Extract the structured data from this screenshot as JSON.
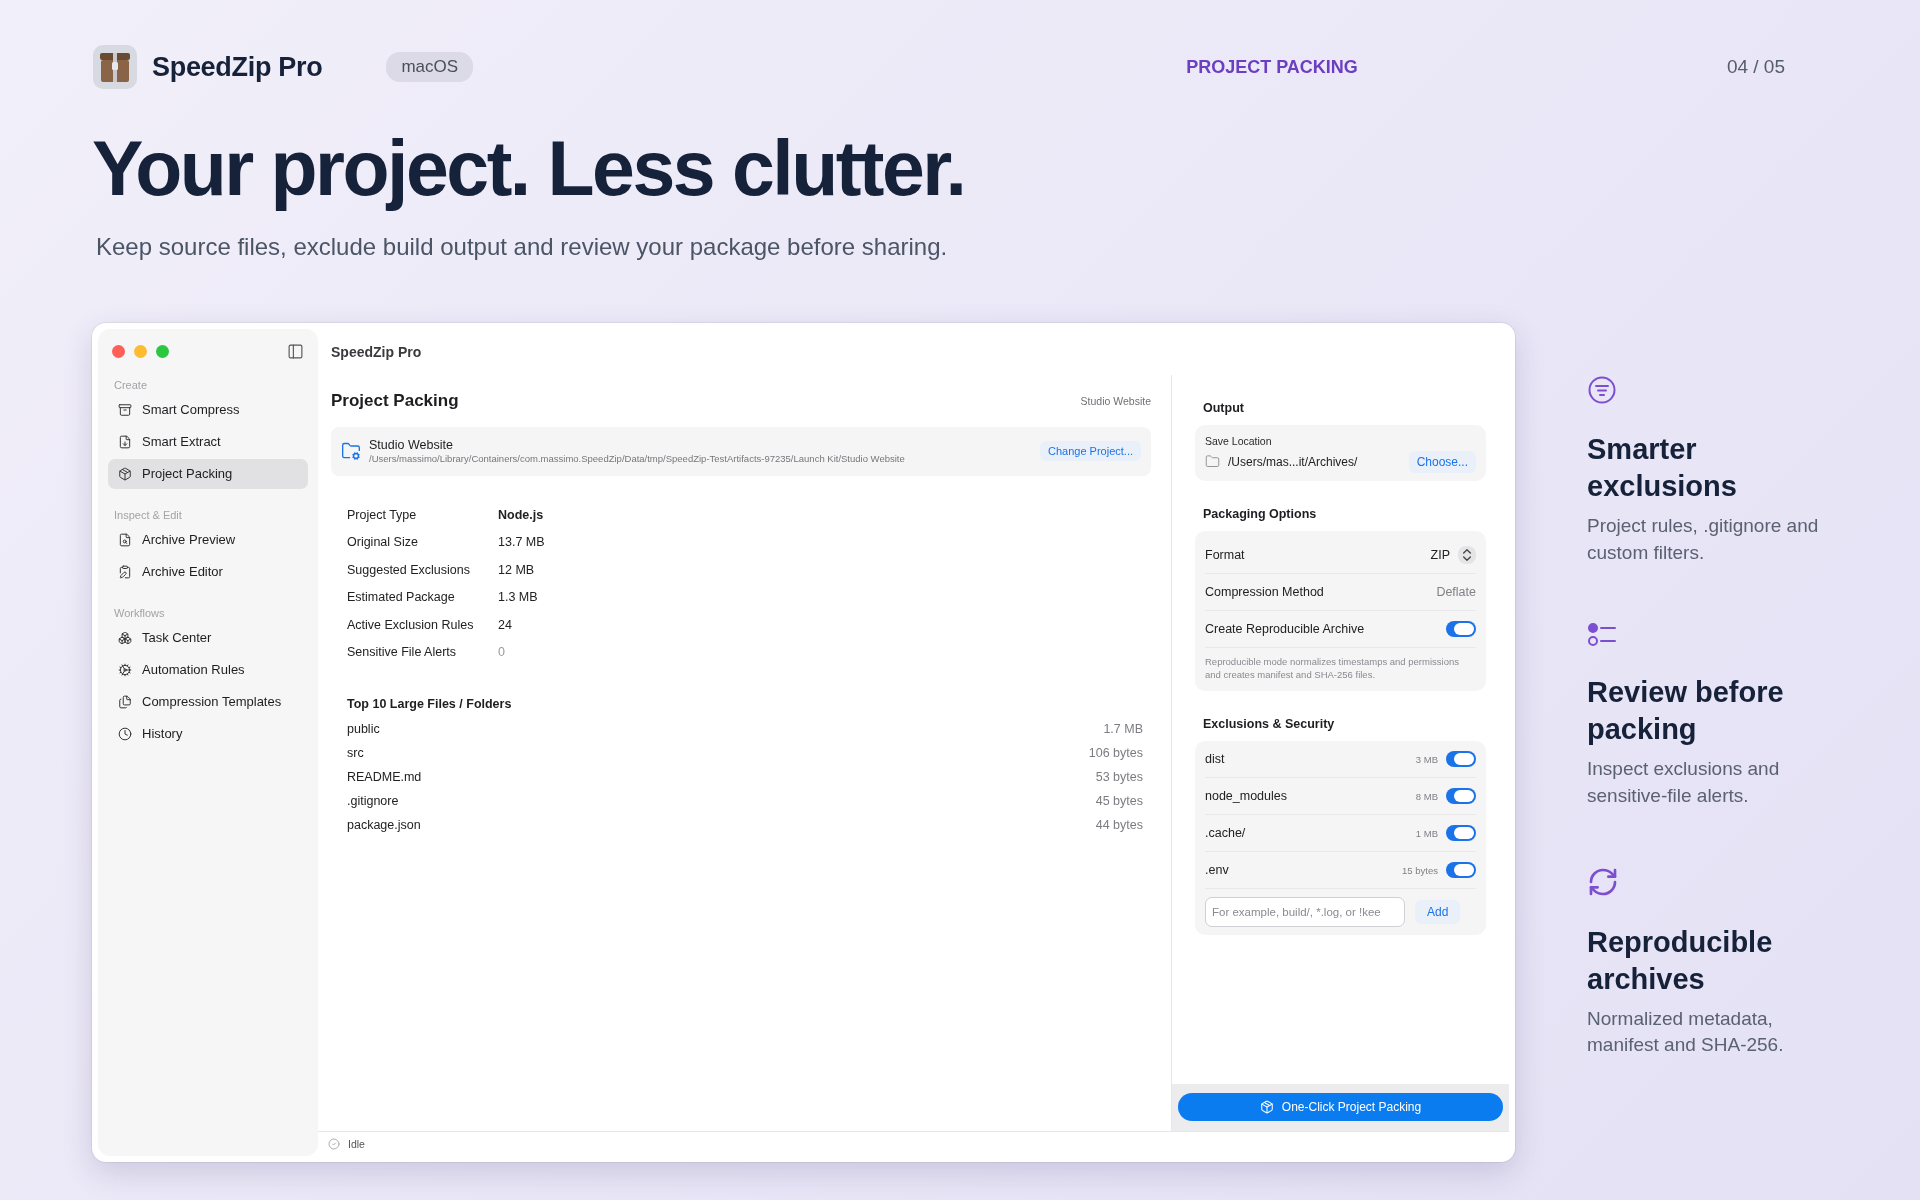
{
  "header": {
    "app_name": "SpeedZip Pro",
    "platform_badge": "macOS",
    "section_label": "PROJECT PACKING",
    "page_counter": "04 / 05"
  },
  "headline": "Your project. Less clutter.",
  "subtitle": "Keep source files, exclude build output and review your package before sharing.",
  "window": {
    "title": "SpeedZip Pro",
    "sidebar": {
      "sections": [
        {
          "heading": "Create",
          "items": [
            {
              "label": "Smart Compress",
              "selected": false
            },
            {
              "label": "Smart Extract",
              "selected": false
            },
            {
              "label": "Project Packing",
              "selected": true
            }
          ]
        },
        {
          "heading": "Inspect & Edit",
          "items": [
            {
              "label": "Archive Preview",
              "selected": false
            },
            {
              "label": "Archive Editor",
              "selected": false
            }
          ]
        },
        {
          "heading": "Workflows",
          "items": [
            {
              "label": "Task Center",
              "selected": false
            },
            {
              "label": "Automation Rules",
              "selected": false
            },
            {
              "label": "Compression Templates",
              "selected": false
            },
            {
              "label": "History",
              "selected": false
            }
          ]
        }
      ]
    },
    "main": {
      "title": "Project Packing",
      "project_badge": "Studio Website",
      "project": {
        "name": "Studio Website",
        "path": "/Users/massimo/Library/Containers/com.massimo.SpeedZip/Data/tmp/SpeedZip-TestArtifacts-97235/Launch Kit/Studio Website",
        "action": "Change Project..."
      },
      "stats": [
        {
          "label": "Project Type",
          "value": "Node.js",
          "kind": "bold"
        },
        {
          "label": "Original Size",
          "value": "13.7 MB",
          "kind": "plain"
        },
        {
          "label": "Suggested Exclusions",
          "value": "12 MB",
          "kind": "plain"
        },
        {
          "label": "Estimated Package",
          "value": "1.3 MB",
          "kind": "plain"
        },
        {
          "label": "Active Exclusion Rules",
          "value": "24",
          "kind": "plain"
        },
        {
          "label": "Sensitive File Alerts",
          "value": "0",
          "kind": "muted"
        }
      ],
      "files": {
        "heading": "Top 10 Large Files / Folders",
        "rows": [
          {
            "name": "public",
            "size": "1.7 MB"
          },
          {
            "name": "src",
            "size": "106 bytes"
          },
          {
            "name": "README.md",
            "size": "53 bytes"
          },
          {
            "name": ".gitignore",
            "size": "45 bytes"
          },
          {
            "name": "package.json",
            "size": "44 bytes"
          }
        ]
      }
    },
    "panel": {
      "output": {
        "heading": "Output",
        "save_label": "Save Location",
        "path": "/Users/mas...it/Archives/",
        "button": "Choose..."
      },
      "options": {
        "heading": "Packaging Options",
        "rows": [
          {
            "kind": "select",
            "label": "Format",
            "value": "ZIP"
          },
          {
            "kind": "value",
            "label": "Compression Method",
            "value": "Deflate"
          },
          {
            "kind": "toggle",
            "label": "Create Reproducible Archive",
            "on": true
          }
        ],
        "note": "Reproducible mode normalizes timestamps and permissions and creates manifest and SHA-256 files."
      },
      "exclusions": {
        "heading": "Exclusions & Security",
        "rows": [
          {
            "name": "dist",
            "size": "3 MB",
            "on": true
          },
          {
            "name": "node_modules",
            "size": "8 MB",
            "on": true
          },
          {
            "name": ".cache/",
            "size": "1 MB",
            "on": true
          },
          {
            "name": ".env",
            "size": "15 bytes",
            "on": true
          }
        ],
        "input": {
          "placeholder": "For example, build/, *.log, or !kee"
        },
        "add": "Add"
      },
      "action_button": "One-Click Project Packing"
    },
    "status": "Idle"
  },
  "features": [
    {
      "title": "Smarter exclusions",
      "text": "Project rules, .gitignore and custom filters."
    },
    {
      "title": "Review before packing",
      "text": "Inspect exclusions and sensitive-file alerts."
    },
    {
      "title": "Reproducible archives",
      "text": "Normalized metadata, manifest and SHA-256."
    }
  ]
}
